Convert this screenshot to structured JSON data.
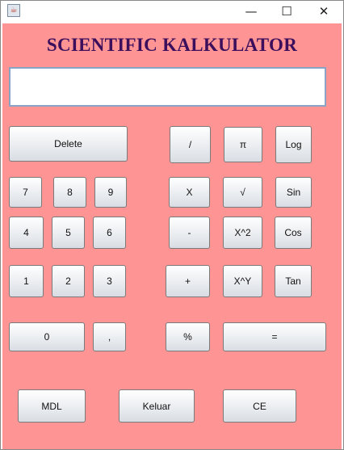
{
  "window": {
    "icon": "java-app-icon",
    "minimize": "—",
    "maximize": "☐",
    "close": "✕"
  },
  "app": {
    "title": "SCIENTIFIC KALKULATOR",
    "display_value": ""
  },
  "buttons": {
    "delete": "Delete",
    "divide": "/",
    "pi": "π",
    "log": "Log",
    "seven": "7",
    "eight": "8",
    "nine": "9",
    "multiply": "X",
    "sqrt": "√",
    "sin": "Sin",
    "four": "4",
    "five": "5",
    "six": "6",
    "minus": "-",
    "square": "X^2",
    "cos": "Cos",
    "one": "1",
    "two": "2",
    "three": "3",
    "plus": "+",
    "power": "X^Y",
    "tan": "Tan",
    "zero": "0",
    "comma": ",",
    "percent": "%",
    "equals": "=",
    "mdl": "MDL",
    "keluar": "Keluar",
    "ce": "CE"
  },
  "colors": {
    "background": "#fe9494",
    "title": "#3b0f5c",
    "display_border": "#8aa4c6"
  }
}
